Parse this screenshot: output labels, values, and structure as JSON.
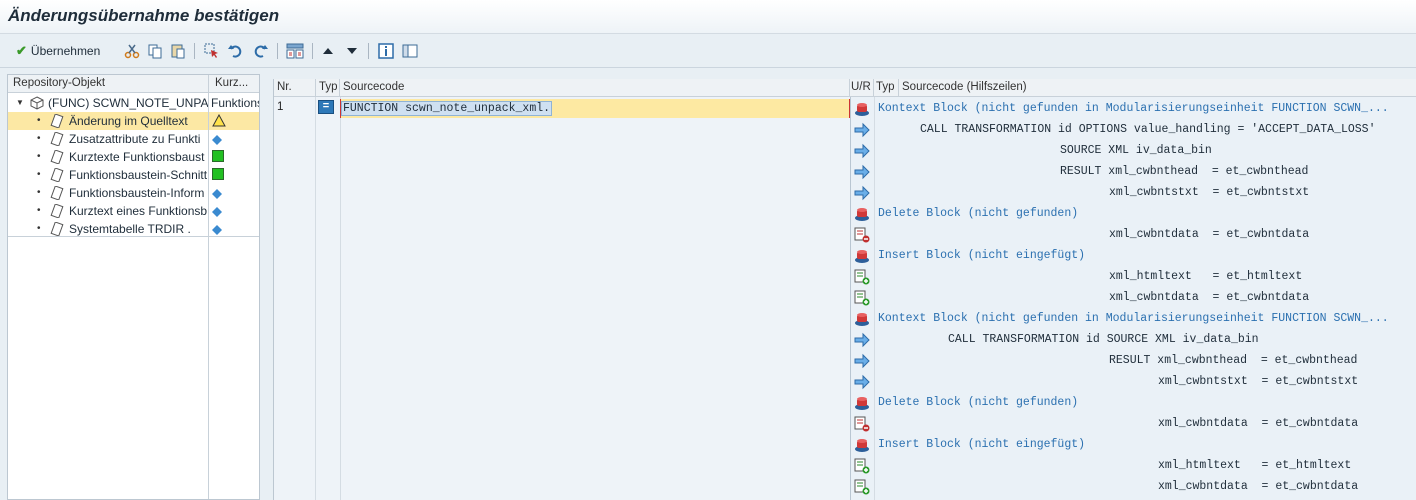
{
  "window": {
    "title": "Änderungsübernahme bestätigen"
  },
  "toolbar": {
    "accept_label": "Übernehmen",
    "icons": [
      "cut-icon",
      "copy-icon",
      "paste-icon",
      "select-icon",
      "undo-icon",
      "redo-icon",
      "layout-icon",
      "arrow-up-icon",
      "arrow-down-icon",
      "info-icon",
      "panel-icon"
    ]
  },
  "tree": {
    "headers": [
      "Repository-Objekt",
      "Kurz..."
    ],
    "root": {
      "label": "(FUNC)  SCWN_NOTE_UNPA",
      "col2": "Funktions"
    },
    "items": [
      {
        "label": "Änderung im Quelltext",
        "status": "warning"
      },
      {
        "label": "Zusatzattribute zu Funkti",
        "status": "diamond"
      },
      {
        "label": "Kurztexte Funktionsbaust",
        "status": "green"
      },
      {
        "label": "Funktionsbaustein-Schnitt",
        "status": "green"
      },
      {
        "label": "Funktionsbaustein-Inform",
        "status": "diamond"
      },
      {
        "label": "Kurztext eines Funktionsb",
        "status": "diamond"
      },
      {
        "label": "Systemtabelle TRDIR .",
        "status": "diamond"
      }
    ]
  },
  "code": {
    "headers": {
      "nr": "Nr.",
      "typ": "Typ",
      "source": "Sourcecode",
      "ur": "U/R",
      "typ2": "Typ",
      "source2": "Sourcecode (Hilfszeilen)"
    },
    "left_lines": [
      {
        "nr": "1",
        "typ_symbol": "=",
        "text": "FUNCTION scwn_note_unpack_xml."
      }
    ],
    "right_lines": [
      {
        "icon": "block",
        "kind": "block",
        "indent": 0,
        "text": "Kontext Block (nicht gefunden in Modularisierungseinheit FUNCTION SCWN_..."
      },
      {
        "icon": "arrow",
        "kind": "code",
        "indent": 6,
        "text": "CALL TRANSFORMATION id OPTIONS value_handling = 'ACCEPT_DATA_LOSS'"
      },
      {
        "icon": "arrow",
        "kind": "code",
        "indent": 26,
        "text": "SOURCE XML iv_data_bin"
      },
      {
        "icon": "arrow",
        "kind": "code",
        "indent": 26,
        "text": "RESULT xml_cwbnthead  = et_cwbnthead"
      },
      {
        "icon": "arrow",
        "kind": "code",
        "indent": 33,
        "text": "xml_cwbntstxt  = et_cwbntstxt"
      },
      {
        "icon": "block",
        "kind": "block",
        "indent": 0,
        "text": "Delete Block (nicht gefunden)"
      },
      {
        "icon": "delete",
        "kind": "code",
        "indent": 33,
        "text": "xml_cwbntdata  = et_cwbntdata"
      },
      {
        "icon": "block",
        "kind": "block",
        "indent": 0,
        "text": "Insert Block (nicht eingefügt)"
      },
      {
        "icon": "insert",
        "kind": "code",
        "indent": 33,
        "text": "xml_htmltext   = et_htmltext"
      },
      {
        "icon": "insert",
        "kind": "code",
        "indent": 33,
        "text": "xml_cwbntdata  = et_cwbntdata"
      },
      {
        "icon": "block",
        "kind": "block",
        "indent": 0,
        "text": "Kontext Block (nicht gefunden in Modularisierungseinheit FUNCTION SCWN_..."
      },
      {
        "icon": "arrow",
        "kind": "code",
        "indent": 10,
        "text": "CALL TRANSFORMATION id SOURCE XML iv_data_bin"
      },
      {
        "icon": "arrow",
        "kind": "code",
        "indent": 33,
        "text": "RESULT xml_cwbnthead  = et_cwbnthead"
      },
      {
        "icon": "arrow",
        "kind": "code",
        "indent": 40,
        "text": "xml_cwbntstxt  = et_cwbntstxt"
      },
      {
        "icon": "block",
        "kind": "block",
        "indent": 0,
        "text": "Delete Block (nicht gefunden)"
      },
      {
        "icon": "delete",
        "kind": "code",
        "indent": 40,
        "text": "xml_cwbntdata  = et_cwbntdata"
      },
      {
        "icon": "block",
        "kind": "block",
        "indent": 0,
        "text": "Insert Block (nicht eingefügt)"
      },
      {
        "icon": "insert",
        "kind": "code",
        "indent": 40,
        "text": "xml_htmltext   = et_htmltext"
      },
      {
        "icon": "insert",
        "kind": "code",
        "indent": 40,
        "text": "xml_cwbntdata  = et_cwbntdata"
      }
    ]
  },
  "colors": {
    "block_text": "#2b70b0",
    "highlight": "#fde9a2",
    "selection": "#fce8a4",
    "status_green": "#22c022",
    "status_warning": "#ffe24a"
  }
}
